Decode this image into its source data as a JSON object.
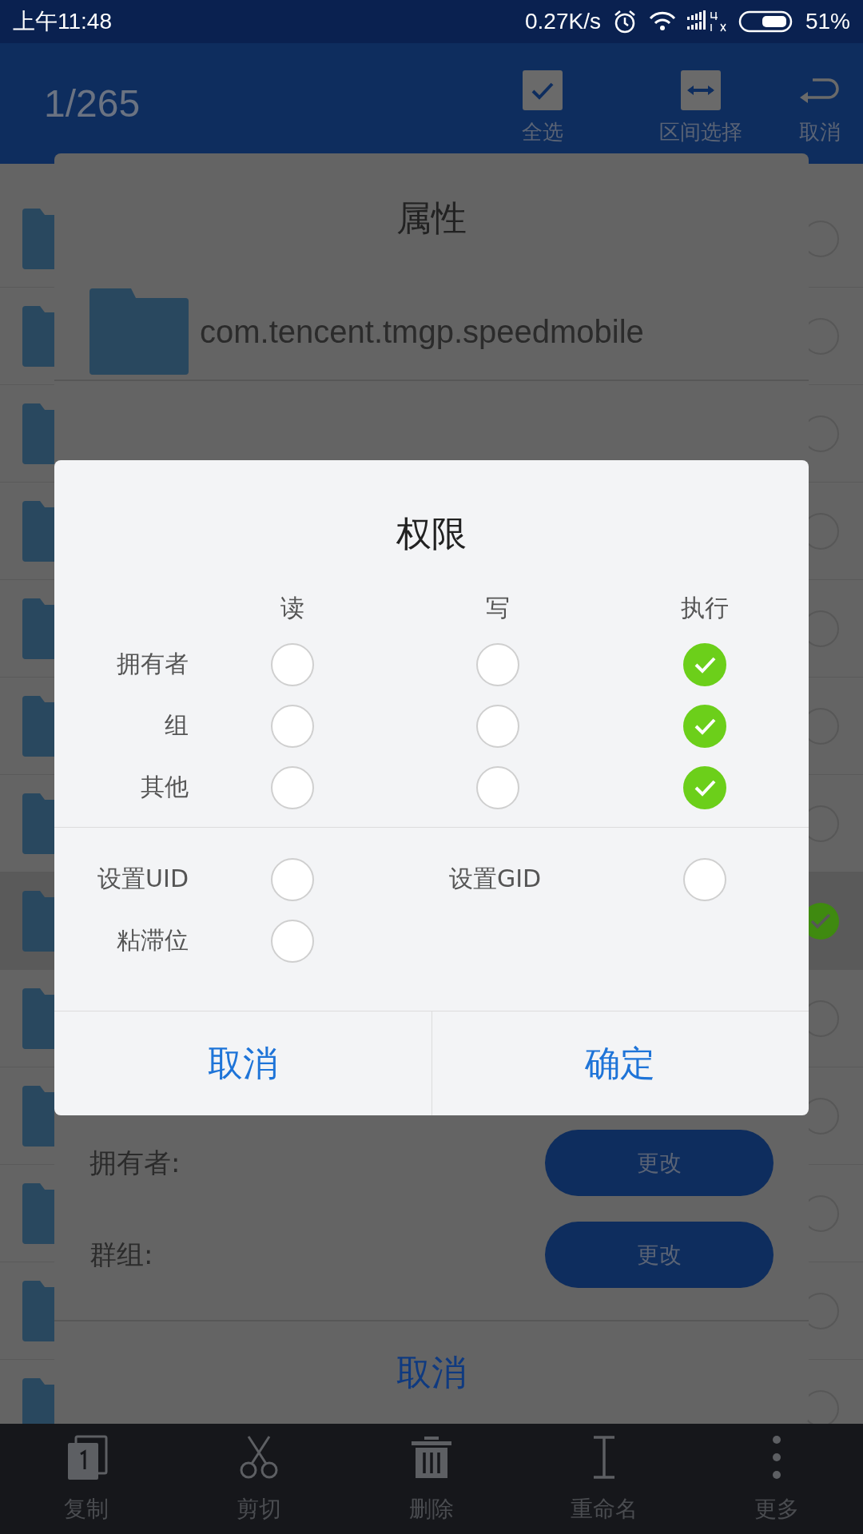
{
  "status_bar": {
    "time": "上午11:48",
    "speed": "0.27K/s",
    "battery": "51%"
  },
  "header": {
    "counter": "1/265",
    "actions": [
      {
        "kind": "select_all",
        "label": "全选"
      },
      {
        "kind": "range",
        "label": "区间选择"
      },
      {
        "kind": "cancel",
        "label": "取消"
      }
    ]
  },
  "list": {
    "rows": [
      {
        "selected": false
      },
      {
        "selected": false
      },
      {
        "selected": false
      },
      {
        "selected": false
      },
      {
        "selected": false
      },
      {
        "selected": false
      },
      {
        "selected": false
      },
      {
        "selected": true
      },
      {
        "selected": false
      },
      {
        "selected": false
      },
      {
        "selected": false
      },
      {
        "selected": false
      },
      {
        "selected": false
      }
    ]
  },
  "properties_dialog": {
    "title": "属性",
    "name": "com.tencent.tmgp.speedmobile",
    "owner_label": "拥有者:",
    "owner_button": "更改",
    "group_label": "群组:",
    "group_button": "更改",
    "cancel": "取消"
  },
  "permissions_dialog": {
    "title": "权限",
    "columns": [
      "读",
      "写",
      "执行"
    ],
    "rows": [
      {
        "label": "拥有者",
        "cells": [
          {
            "checked": false
          },
          {
            "checked": false
          },
          {
            "checked": true
          }
        ]
      },
      {
        "label": "组",
        "cells": [
          {
            "checked": false
          },
          {
            "checked": false
          },
          {
            "checked": true
          }
        ]
      },
      {
        "label": "其他",
        "cells": [
          {
            "checked": false
          },
          {
            "checked": false
          },
          {
            "checked": true
          }
        ]
      }
    ],
    "special": [
      {
        "label": "设置UID",
        "checked": false
      },
      {
        "label": "设置GID",
        "checked": false
      },
      {
        "label": "粘滞位",
        "checked": false
      }
    ],
    "buttons": [
      "取消",
      "确定"
    ]
  },
  "toolbar": {
    "items": [
      {
        "kind": "copy",
        "label": "复制"
      },
      {
        "kind": "cut",
        "label": "剪切"
      },
      {
        "kind": "delete",
        "label": "删除"
      },
      {
        "kind": "rename",
        "label": "重命名"
      },
      {
        "kind": "more",
        "label": "更多"
      }
    ]
  }
}
